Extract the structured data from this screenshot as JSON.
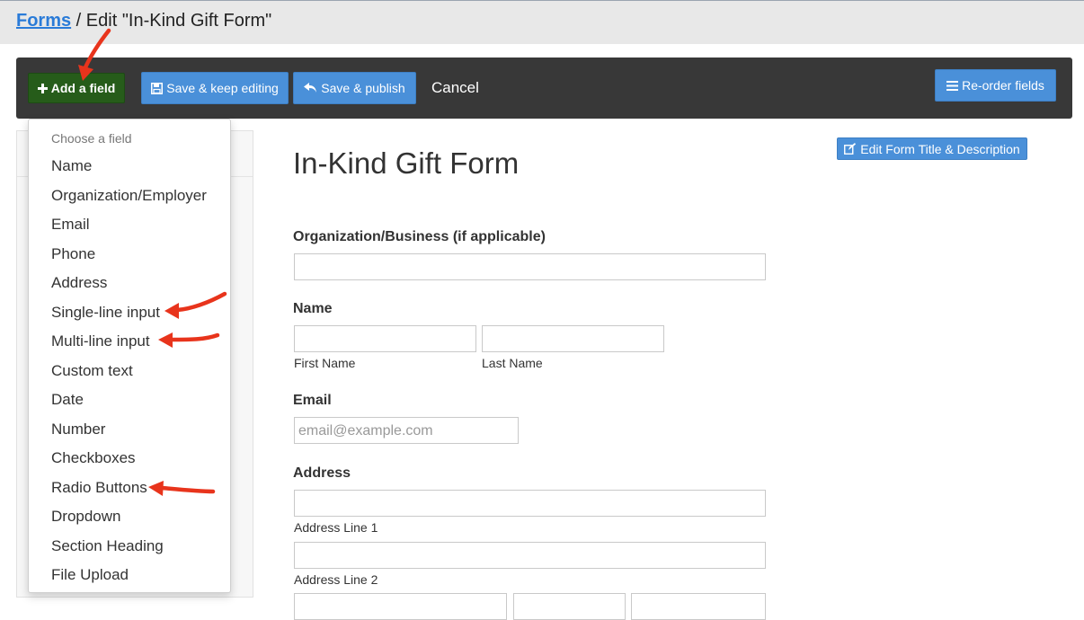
{
  "header": {
    "breadcrumb_link": "Forms",
    "breadcrumb_rest": " / Edit \"In-Kind Gift Form\""
  },
  "toolbar": {
    "add_field": "Add a field",
    "save_keep": "Save & keep editing",
    "save_publish": "Save & publish",
    "cancel": "Cancel",
    "reorder": "Re-order fields"
  },
  "dropdown": {
    "header": "Choose a field",
    "items": [
      "Name",
      "Organization/Employer",
      "Email",
      "Phone",
      "Address",
      "Single-line input",
      "Multi-line input",
      "Custom text",
      "Date",
      "Number",
      "Checkboxes",
      "Radio Buttons",
      "Dropdown",
      "Section Heading",
      "File Upload"
    ]
  },
  "form": {
    "edit_title_button": "Edit Form Title & Description",
    "title": "In-Kind Gift Form",
    "fields": {
      "organization_label": "Organization/Business (if applicable)",
      "name_label": "Name",
      "first_name": "First Name",
      "last_name": "Last Name",
      "email_label": "Email",
      "email_placeholder": "email@example.com",
      "address_label": "Address",
      "address_line1": "Address Line 1",
      "address_line2": "Address Line 2"
    }
  },
  "colors": {
    "accent_blue": "#4a90d9",
    "add_green": "#265c1a",
    "toolbar_dark": "#383838",
    "annotation_arrow": "#e8341c"
  },
  "icons": [
    "plus-icon",
    "save-icon",
    "undo-icon",
    "list-icon",
    "edit-icon"
  ]
}
